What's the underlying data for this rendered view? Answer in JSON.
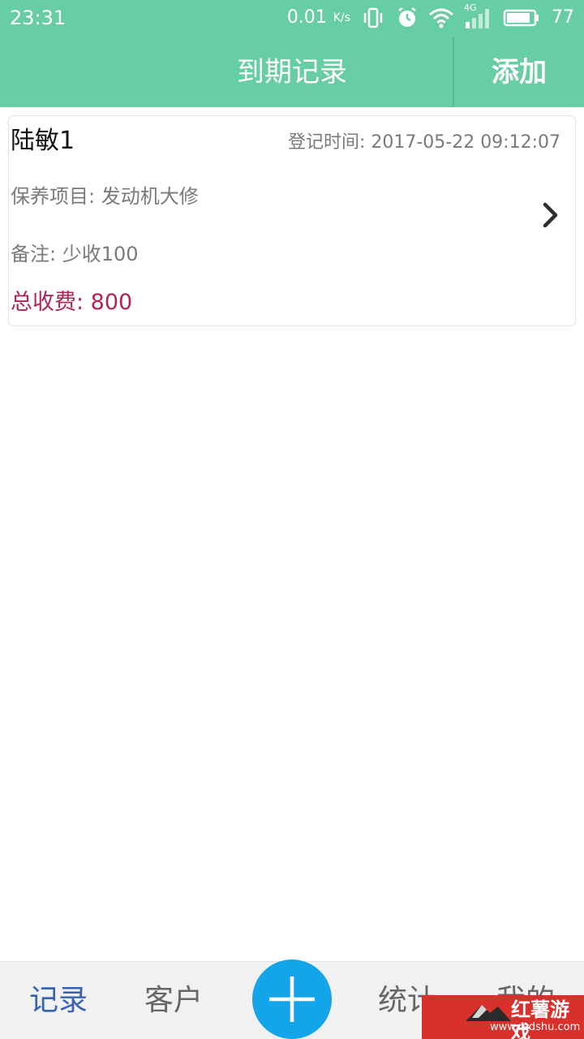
{
  "status_bar": {
    "time": "23:31",
    "net_speed": "0.01",
    "net_speed_unit": "K/s",
    "network_type": "4G",
    "battery": "77",
    "icons": [
      "vibrate-icon",
      "alarm-icon",
      "wifi-icon",
      "signal-icon",
      "battery-icon"
    ]
  },
  "header": {
    "title": "到期记录",
    "add_label": "添加"
  },
  "records": [
    {
      "name": "陆敏1",
      "registered_at": "登记时间: 2017-05-22 09:12:07",
      "maintenance_item": "保养项目: 发动机大修",
      "note": "备注: 少收100",
      "total_fee": "总收费: 800",
      "icon": "chevron-right-icon"
    }
  ],
  "bottom_nav": {
    "records": "记录",
    "customers": "客户",
    "add_icon": "plus-icon",
    "stats": "统计",
    "mine": "我的"
  },
  "watermark": {
    "title": "红薯游戏",
    "url": "www.redshu.com"
  },
  "colors": {
    "header_bg": "#67cda5",
    "fee_text": "#b0245a",
    "nav_active": "#3a63b0",
    "fab_bg": "#14a4ea",
    "watermark_bg": "#d9302c"
  }
}
